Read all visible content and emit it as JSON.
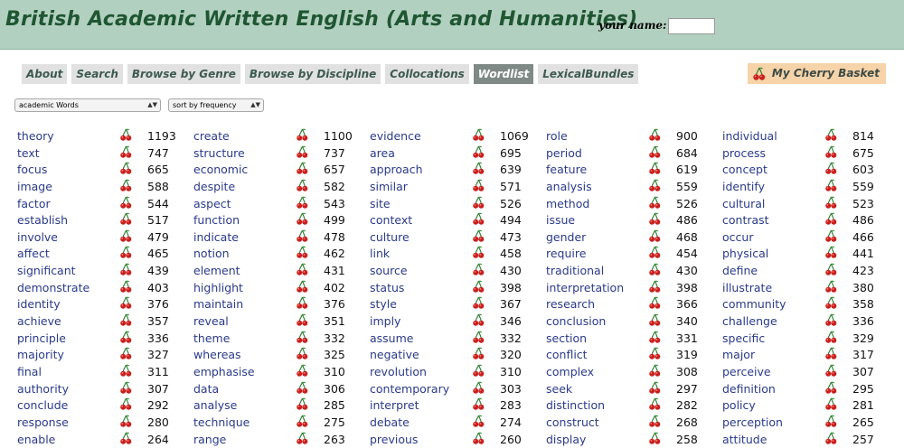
{
  "header": {
    "title": "British Academic Written English (Arts and Humanities)",
    "name_label": "your name:",
    "name_value": ""
  },
  "nav": [
    {
      "label": "About",
      "active": false
    },
    {
      "label": "Search",
      "active": false
    },
    {
      "label": "Browse by Genre",
      "active": false
    },
    {
      "label": "Browse by Discipline",
      "active": false
    },
    {
      "label": "Collocations",
      "active": false
    },
    {
      "label": "Wordlist",
      "active": true
    },
    {
      "label": "LexicalBundles",
      "active": false
    }
  ],
  "basket": {
    "label": "My Cherry Basket",
    "icon": "cherry-icon"
  },
  "controls": {
    "list_select": "academic Words",
    "sort_select": "sort by frequency"
  },
  "colors": {
    "header_bg": "#b2d0c0",
    "title": "#1f5632",
    "active_tab": "#7f8a86",
    "basket_bg": "#f6d3a8",
    "link": "#2a3a88",
    "cherry": "#c8201e"
  },
  "wordlist": [
    [
      {
        "word": "theory",
        "count": "1193"
      },
      {
        "word": "text",
        "count": "747"
      },
      {
        "word": "focus",
        "count": "665"
      },
      {
        "word": "image",
        "count": "588"
      },
      {
        "word": "factor",
        "count": "544"
      },
      {
        "word": "establish",
        "count": "517"
      },
      {
        "word": "involve",
        "count": "479"
      },
      {
        "word": "affect",
        "count": "465"
      },
      {
        "word": "significant",
        "count": "439"
      },
      {
        "word": "demonstrate",
        "count": "403"
      },
      {
        "word": "identity",
        "count": "376"
      },
      {
        "word": "achieve",
        "count": "357"
      },
      {
        "word": "principle",
        "count": "336"
      },
      {
        "word": "majority",
        "count": "327"
      },
      {
        "word": "final",
        "count": "311"
      },
      {
        "word": "authority",
        "count": "307"
      },
      {
        "word": "conclude",
        "count": "292"
      },
      {
        "word": "response",
        "count": "280"
      },
      {
        "word": "enable",
        "count": "264"
      }
    ],
    [
      {
        "word": "create",
        "count": "1100"
      },
      {
        "word": "structure",
        "count": "737"
      },
      {
        "word": "economic",
        "count": "657"
      },
      {
        "word": "despite",
        "count": "582"
      },
      {
        "word": "aspect",
        "count": "543"
      },
      {
        "word": "function",
        "count": "499"
      },
      {
        "word": "indicate",
        "count": "478"
      },
      {
        "word": "notion",
        "count": "462"
      },
      {
        "word": "element",
        "count": "431"
      },
      {
        "word": "highlight",
        "count": "402"
      },
      {
        "word": "maintain",
        "count": "376"
      },
      {
        "word": "reveal",
        "count": "351"
      },
      {
        "word": "theme",
        "count": "332"
      },
      {
        "word": "whereas",
        "count": "325"
      },
      {
        "word": "emphasise",
        "count": "310"
      },
      {
        "word": "data",
        "count": "306"
      },
      {
        "word": "analyse",
        "count": "285"
      },
      {
        "word": "technique",
        "count": "275"
      },
      {
        "word": "range",
        "count": "263"
      }
    ],
    [
      {
        "word": "evidence",
        "count": "1069"
      },
      {
        "word": "area",
        "count": "695"
      },
      {
        "word": "approach",
        "count": "639"
      },
      {
        "word": "similar",
        "count": "571"
      },
      {
        "word": "site",
        "count": "526"
      },
      {
        "word": "context",
        "count": "494"
      },
      {
        "word": "culture",
        "count": "473"
      },
      {
        "word": "link",
        "count": "458"
      },
      {
        "word": "source",
        "count": "430"
      },
      {
        "word": "status",
        "count": "398"
      },
      {
        "word": "style",
        "count": "367"
      },
      {
        "word": "imply",
        "count": "346"
      },
      {
        "word": "assume",
        "count": "332"
      },
      {
        "word": "negative",
        "count": "320"
      },
      {
        "word": "revolution",
        "count": "310"
      },
      {
        "word": "contemporary",
        "count": "303"
      },
      {
        "word": "interpret",
        "count": "283"
      },
      {
        "word": "debate",
        "count": "274"
      },
      {
        "word": "previous",
        "count": "260"
      }
    ],
    [
      {
        "word": "role",
        "count": "900"
      },
      {
        "word": "period",
        "count": "684"
      },
      {
        "word": "feature",
        "count": "619"
      },
      {
        "word": "analysis",
        "count": "559"
      },
      {
        "word": "method",
        "count": "526"
      },
      {
        "word": "issue",
        "count": "486"
      },
      {
        "word": "gender",
        "count": "468"
      },
      {
        "word": "require",
        "count": "454"
      },
      {
        "word": "traditional",
        "count": "430"
      },
      {
        "word": "interpretation",
        "count": "398"
      },
      {
        "word": "research",
        "count": "366"
      },
      {
        "word": "conclusion",
        "count": "340"
      },
      {
        "word": "section",
        "count": "331"
      },
      {
        "word": "conflict",
        "count": "319"
      },
      {
        "word": "complex",
        "count": "308"
      },
      {
        "word": "seek",
        "count": "297"
      },
      {
        "word": "distinction",
        "count": "282"
      },
      {
        "word": "construct",
        "count": "268"
      },
      {
        "word": "display",
        "count": "258"
      }
    ],
    [
      {
        "word": "individual",
        "count": "814"
      },
      {
        "word": "process",
        "count": "675"
      },
      {
        "word": "concept",
        "count": "603"
      },
      {
        "word": "identify",
        "count": "559"
      },
      {
        "word": "cultural",
        "count": "523"
      },
      {
        "word": "contrast",
        "count": "486"
      },
      {
        "word": "occur",
        "count": "466"
      },
      {
        "word": "physical",
        "count": "441"
      },
      {
        "word": "define",
        "count": "423"
      },
      {
        "word": "illustrate",
        "count": "380"
      },
      {
        "word": "community",
        "count": "358"
      },
      {
        "word": "challenge",
        "count": "336"
      },
      {
        "word": "specific",
        "count": "329"
      },
      {
        "word": "major",
        "count": "317"
      },
      {
        "word": "perceive",
        "count": "307"
      },
      {
        "word": "definition",
        "count": "295"
      },
      {
        "word": "policy",
        "count": "281"
      },
      {
        "word": "perception",
        "count": "265"
      },
      {
        "word": "attitude",
        "count": "257"
      }
    ]
  ]
}
